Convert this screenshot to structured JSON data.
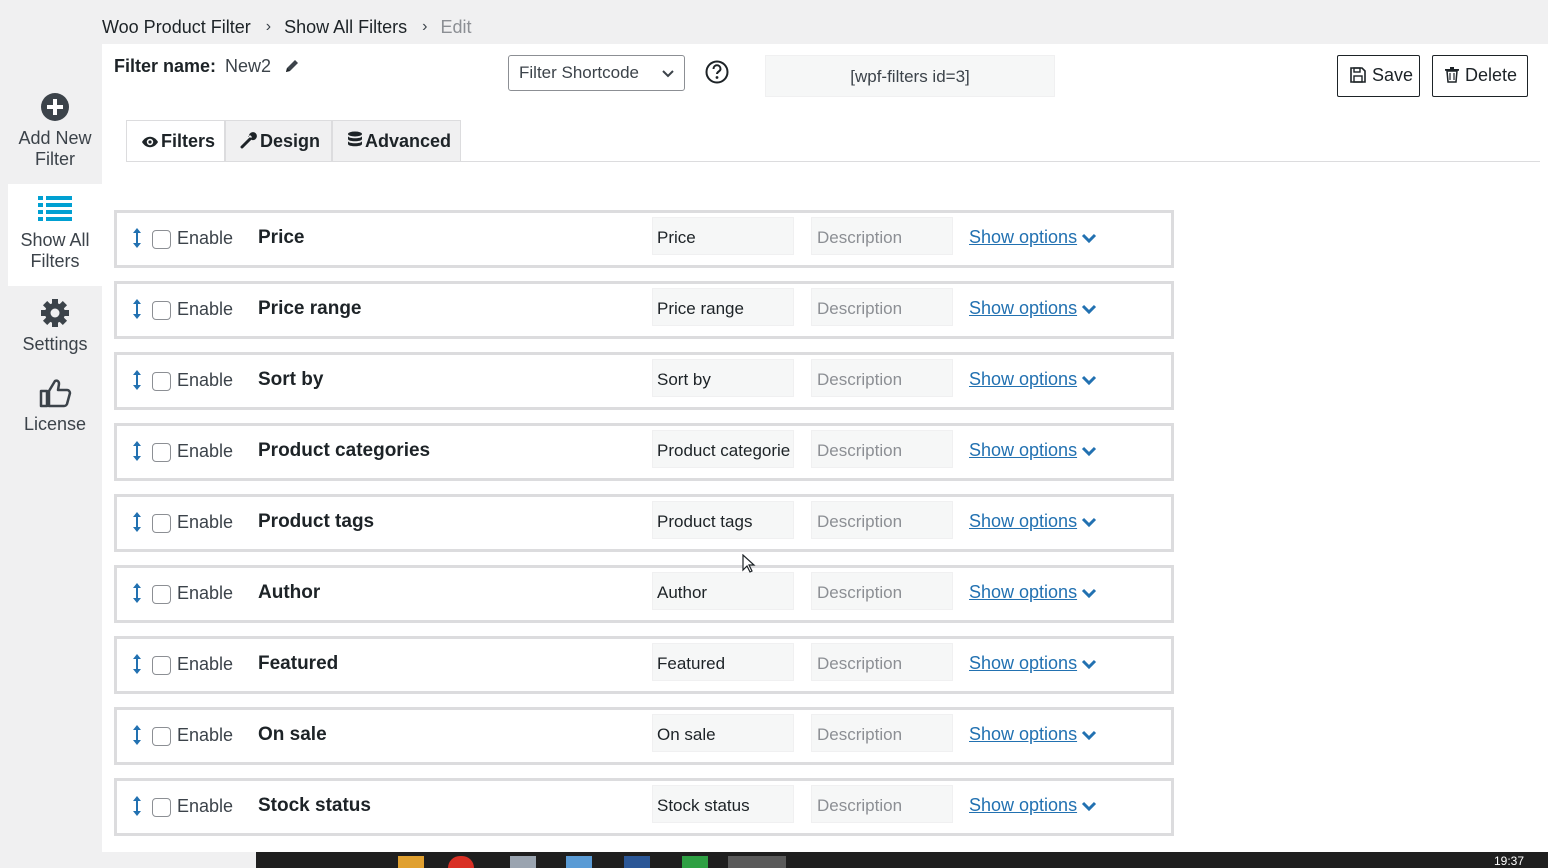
{
  "breadcrumb": {
    "items": [
      "Woo Product Filter",
      "Show All Filters"
    ],
    "current": "Edit"
  },
  "sidebar": {
    "items": [
      {
        "label_line1": "Add New",
        "label_line2": "Filter",
        "icon": "plus-circle-icon"
      },
      {
        "label_line1": "Show All",
        "label_line2": "Filters",
        "icon": "list-icon",
        "active": true
      },
      {
        "label_line1": "Settings",
        "label_line2": "",
        "icon": "gear-icon"
      },
      {
        "label_line1": "License",
        "label_line2": "",
        "icon": "thumbs-up-icon"
      }
    ]
  },
  "header": {
    "filter_name_label": "Filter name:",
    "filter_name_value": "New2",
    "shortcode_select": "Filter Shortcode",
    "shortcode_value": "[wpf-filters id=3]",
    "save_label": "Save",
    "delete_label": "Delete"
  },
  "tabs": [
    {
      "label": "Filters",
      "icon": "eye-icon",
      "active": true
    },
    {
      "label": "Design",
      "icon": "wrench-icon"
    },
    {
      "label": "Advanced",
      "icon": "database-icon"
    }
  ],
  "filters": [
    {
      "enable_label": "Enable",
      "name": "Price",
      "title_value": "Price",
      "description_placeholder": "Description",
      "show_options": "Show options"
    },
    {
      "enable_label": "Enable",
      "name": "Price range",
      "title_value": "Price range",
      "description_placeholder": "Description",
      "show_options": "Show options"
    },
    {
      "enable_label": "Enable",
      "name": "Sort by",
      "title_value": "Sort by",
      "description_placeholder": "Description",
      "show_options": "Show options"
    },
    {
      "enable_label": "Enable",
      "name": "Product categories",
      "title_value": "Product categorie",
      "description_placeholder": "Description",
      "show_options": "Show options"
    },
    {
      "enable_label": "Enable",
      "name": "Product tags",
      "title_value": "Product tags",
      "description_placeholder": "Description",
      "show_options": "Show options"
    },
    {
      "enable_label": "Enable",
      "name": "Author",
      "title_value": "Author",
      "description_placeholder": "Description",
      "show_options": "Show options"
    },
    {
      "enable_label": "Enable",
      "name": "Featured",
      "title_value": "Featured",
      "description_placeholder": "Description",
      "show_options": "Show options"
    },
    {
      "enable_label": "Enable",
      "name": "On sale",
      "title_value": "On sale",
      "description_placeholder": "Description",
      "show_options": "Show options"
    },
    {
      "enable_label": "Enable",
      "name": "Stock status",
      "title_value": "Stock status",
      "description_placeholder": "Description",
      "show_options": "Show options"
    }
  ],
  "taskbar": {
    "clock": "19:37"
  },
  "colors": {
    "link": "#2271b1",
    "sidebar_icon": "#3c434a",
    "list_icon": "#00a0d2"
  }
}
